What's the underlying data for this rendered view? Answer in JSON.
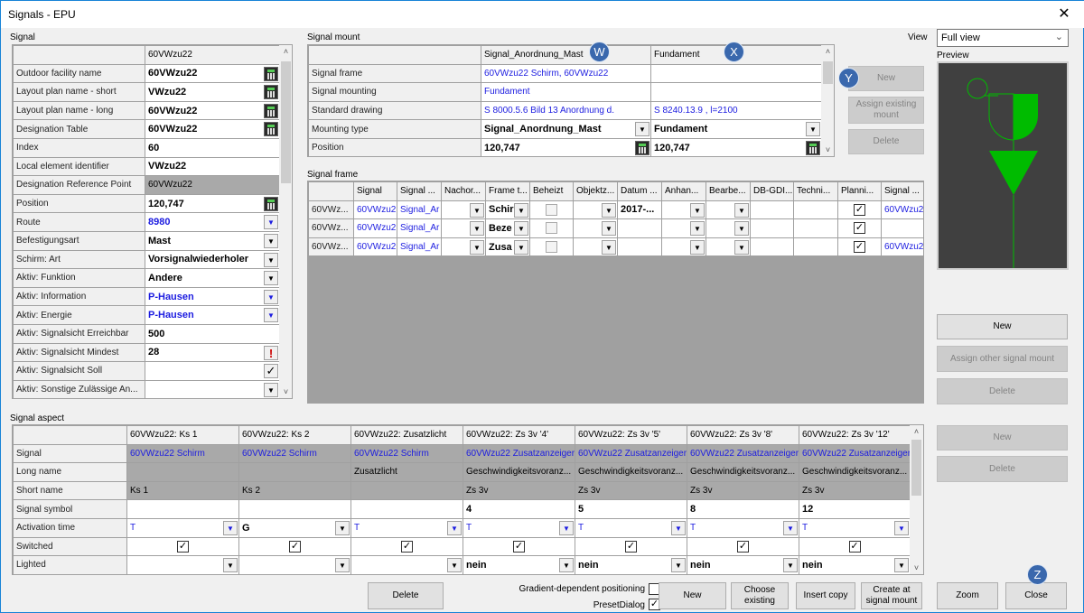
{
  "window": {
    "title": "Signals - EPU",
    "close_icon": "close-icon"
  },
  "signal": {
    "label": "Signal",
    "header": "60VWzu22",
    "rows": [
      {
        "label": "Outdoor facility name",
        "value": "60VWzu22",
        "s": "bold",
        "c": "calc"
      },
      {
        "label": "Layout plan name - short",
        "value": "VWzu22",
        "s": "bold",
        "c": "calc"
      },
      {
        "label": "Layout plan name - long",
        "value": "60VWzu22",
        "s": "bold",
        "c": "calc"
      },
      {
        "label": "Designation Table",
        "value": "60VWzu22",
        "s": "bold",
        "c": "calc"
      },
      {
        "label": "Index",
        "value": "60",
        "s": "bold"
      },
      {
        "label": "Local element identifier",
        "value": "VWzu22",
        "s": "bold"
      },
      {
        "label": "Designation Reference Point",
        "value": "60VWzu22",
        "s": "gray"
      },
      {
        "label": "Position",
        "value": "120,747",
        "s": "bold",
        "c": "calc"
      },
      {
        "label": "Route",
        "value": "8980",
        "s": "bold blue",
        "c": "dd"
      },
      {
        "label": "Befestigungsart",
        "value": "Mast",
        "s": "bold",
        "c": "dd"
      },
      {
        "label": "Schirm: Art",
        "value": "Vorsignalwiederholer",
        "s": "bold",
        "c": "dd"
      },
      {
        "label": "Aktiv: Funktion",
        "value": "Andere",
        "s": "bold",
        "c": "dd"
      },
      {
        "label": "Aktiv: Information",
        "value": "P-Hausen",
        "s": "bold blue",
        "c": "dd"
      },
      {
        "label": "Aktiv: Energie",
        "value": "P-Hausen",
        "s": "bold blue",
        "c": "dd"
      },
      {
        "label": "Aktiv: Signalsicht Erreichbar",
        "value": "500",
        "s": "bold"
      },
      {
        "label": "Aktiv: Signalsicht Mindest",
        "value": "28",
        "s": "bold",
        "c": "warn"
      },
      {
        "label": "Aktiv: Signalsicht Soll",
        "value": "",
        "c": "chk"
      },
      {
        "label": "Aktiv: Sonstige Zulässige An...",
        "value": "",
        "c": "dd"
      },
      {
        "label": "",
        "value": "",
        "c": "dd"
      }
    ]
  },
  "mount": {
    "label": "Signal mount",
    "headers": [
      "Signal_Anordnung_Mast",
      "Fundament"
    ],
    "rows": [
      {
        "label": "Signal frame",
        "values": [
          {
            "t": "60VWzu22 Schirm, 60VWzu22",
            "s": "blue"
          },
          {
            "t": ""
          }
        ]
      },
      {
        "label": "Signal mounting",
        "values": [
          {
            "t": "Fundament",
            "s": "blue"
          },
          {
            "t": ""
          }
        ]
      },
      {
        "label": "Standard drawing",
        "values": [
          {
            "t": "S 8000.5.6 Bild 13 Anordnung d.",
            "s": "blue"
          },
          {
            "t": "S 8240.13.9 , l=2100",
            "s": "blue"
          }
        ]
      },
      {
        "label": "Mounting type",
        "values": [
          {
            "t": "Signal_Anordnung_Mast",
            "s": "bold",
            "c": "dd"
          },
          {
            "t": "Fundament",
            "s": "bold",
            "c": "dd"
          }
        ]
      },
      {
        "label": "Position",
        "values": [
          {
            "t": "120,747",
            "s": "bold",
            "c": "calc"
          },
          {
            "t": "120,747",
            "s": "bold",
            "c": "calc"
          }
        ]
      }
    ],
    "buttons": {
      "new": "New",
      "assign": "Assign existing mount",
      "delete": "Delete"
    }
  },
  "view": {
    "label": "View",
    "selected": "Full view",
    "preview_label": "Preview",
    "accent": "#00bb00",
    "background": "#404040"
  },
  "frame": {
    "label": "Signal frame",
    "headers": [
      "",
      "Signal",
      "Signal ...",
      "Nachor...",
      "Frame t...",
      "Beheizt",
      "Objektz...",
      "Datum ...",
      "Anhan...",
      "Bearbe...",
      "DB-GDI...",
      "Techni...",
      "Planni...",
      "Signal ..."
    ],
    "rows": [
      [
        {
          "t": "60VWz...",
          "s": "rh"
        },
        {
          "t": "60VWzu2",
          "s": "blue"
        },
        {
          "t": "Signal_Ar",
          "s": "blue"
        },
        {
          "c": "dd"
        },
        {
          "t": "Schir",
          "s": "bold",
          "c": "dd"
        },
        {
          "cb": false,
          "off": true
        },
        {
          "c": "dd"
        },
        {
          "t": "2017-...",
          "s": "bold"
        },
        {
          "c": "dd"
        },
        {
          "c": "dd"
        },
        {},
        {},
        {
          "cb": true
        },
        {
          "t": "60VWzu2",
          "s": "blue"
        }
      ],
      [
        {
          "t": "60VWz...",
          "s": "rh"
        },
        {
          "t": "60VWzu2",
          "s": "blue"
        },
        {
          "t": "Signal_Ar",
          "s": "blue"
        },
        {
          "c": "dd"
        },
        {
          "t": "Beze",
          "s": "bold",
          "c": "dd"
        },
        {
          "cb": false,
          "off": true
        },
        {
          "c": "dd"
        },
        {},
        {
          "c": "dd"
        },
        {
          "c": "dd"
        },
        {},
        {},
        {
          "cb": true
        },
        {}
      ],
      [
        {
          "t": "60VWz...",
          "s": "rh"
        },
        {
          "t": "60VWzu2",
          "s": "blue"
        },
        {
          "t": "Signal_Ar",
          "s": "blue"
        },
        {
          "c": "dd"
        },
        {
          "t": "Zusa",
          "s": "bold",
          "c": "dd"
        },
        {
          "cb": false,
          "off": true
        },
        {
          "c": "dd"
        },
        {},
        {
          "c": "dd"
        },
        {
          "c": "dd"
        },
        {},
        {},
        {
          "cb": true
        },
        {
          "t": "60VWzu2",
          "s": "blue"
        }
      ]
    ],
    "buttons": {
      "new": "New",
      "assign": "Assign other signal mount",
      "delete": "Delete"
    }
  },
  "aspect": {
    "label": "Signal aspect",
    "headers": [
      "",
      "60VWzu22: Ks 1",
      "60VWzu22: Ks 2",
      "60VWzu22: Zusatzlicht",
      "60VWzu22: Zs 3v '4'",
      "60VWzu22: Zs 3v '5'",
      "60VWzu22: Zs 3v '8'",
      "60VWzu22: Zs 3v '12'"
    ],
    "rows": [
      [
        {
          "t": "Signal",
          "s": "rh"
        },
        {
          "t": "60VWzu22 Schirm",
          "s": "gray blue"
        },
        {
          "t": "60VWzu22 Schirm",
          "s": "gray blue"
        },
        {
          "t": "60VWzu22 Schirm",
          "s": "gray blue"
        },
        {
          "t": "60VWzu22 Zusatzanzeiger",
          "s": "gray blue"
        },
        {
          "t": "60VWzu22 Zusatzanzeiger",
          "s": "gray blue"
        },
        {
          "t": "60VWzu22 Zusatzanzeiger",
          "s": "gray blue"
        },
        {
          "t": "60VWzu22 Zusatzanzeiger",
          "s": "gray blue"
        }
      ],
      [
        {
          "t": "Long name",
          "s": "rh"
        },
        {
          "s": "gray"
        },
        {
          "s": "gray"
        },
        {
          "t": "Zusatzlicht",
          "s": "gray"
        },
        {
          "t": "Geschwindigkeitsvoranz...",
          "s": "gray"
        },
        {
          "t": "Geschwindigkeitsvoranz...",
          "s": "gray"
        },
        {
          "t": "Geschwindigkeitsvoranz...",
          "s": "gray"
        },
        {
          "t": "Geschwindigkeitsvoranz...",
          "s": "gray"
        }
      ],
      [
        {
          "t": "Short name",
          "s": "rh"
        },
        {
          "t": "Ks 1",
          "s": "gray"
        },
        {
          "t": "Ks 2",
          "s": "gray"
        },
        {
          "s": "gray"
        },
        {
          "t": "Zs 3v",
          "s": "gray"
        },
        {
          "t": "Zs 3v",
          "s": "gray"
        },
        {
          "t": "Zs 3v",
          "s": "gray"
        },
        {
          "t": "Zs 3v",
          "s": "gray"
        }
      ],
      [
        {
          "t": "Signal symbol",
          "s": "rh"
        },
        {},
        {},
        {},
        {
          "t": "4",
          "s": "bold"
        },
        {
          "t": "5",
          "s": "bold"
        },
        {
          "t": "8",
          "s": "bold"
        },
        {
          "t": "12",
          "s": "bold"
        }
      ],
      [
        {
          "t": "Activation time",
          "s": "rh"
        },
        {
          "t": "T",
          "s": "blue",
          "c": "dd"
        },
        {
          "t": "G",
          "s": "bold",
          "c": "dd"
        },
        {
          "t": "T",
          "s": "blue",
          "c": "dd"
        },
        {
          "t": "T",
          "s": "blue",
          "c": "dd"
        },
        {
          "t": "T",
          "s": "blue",
          "c": "dd"
        },
        {
          "t": "T",
          "s": "blue",
          "c": "dd"
        },
        {
          "t": "T",
          "s": "blue",
          "c": "dd"
        }
      ],
      [
        {
          "t": "Switched",
          "s": "rh"
        },
        {
          "cb": true
        },
        {
          "cb": true
        },
        {
          "cb": true
        },
        {
          "cb": true
        },
        {
          "cb": true
        },
        {
          "cb": true
        },
        {
          "cb": true
        }
      ],
      [
        {
          "t": "Lighted",
          "s": "rh"
        },
        {
          "c": "dd"
        },
        {
          "c": "dd"
        },
        {
          "c": "dd"
        },
        {
          "t": "nein",
          "s": "bold",
          "c": "dd"
        },
        {
          "t": "nein",
          "s": "bold",
          "c": "dd"
        },
        {
          "t": "nein",
          "s": "bold",
          "c": "dd"
        },
        {
          "t": "nein",
          "s": "bold",
          "c": "dd"
        }
      ]
    ],
    "buttons": {
      "new": "New",
      "delete": "Delete"
    }
  },
  "bottom": {
    "delete": "Delete",
    "gradient_label": "Gradient-dependent positioning",
    "gradient_checked": false,
    "preset_label": "PresetDialog",
    "preset_checked": true,
    "new": "New",
    "choose": "Choose existing",
    "insert": "Insert copy",
    "create": "Create at signal mount",
    "zoom": "Zoom",
    "close": "Close"
  },
  "markers": {
    "w": "W",
    "x": "X",
    "y": "Y",
    "z": "Z"
  }
}
